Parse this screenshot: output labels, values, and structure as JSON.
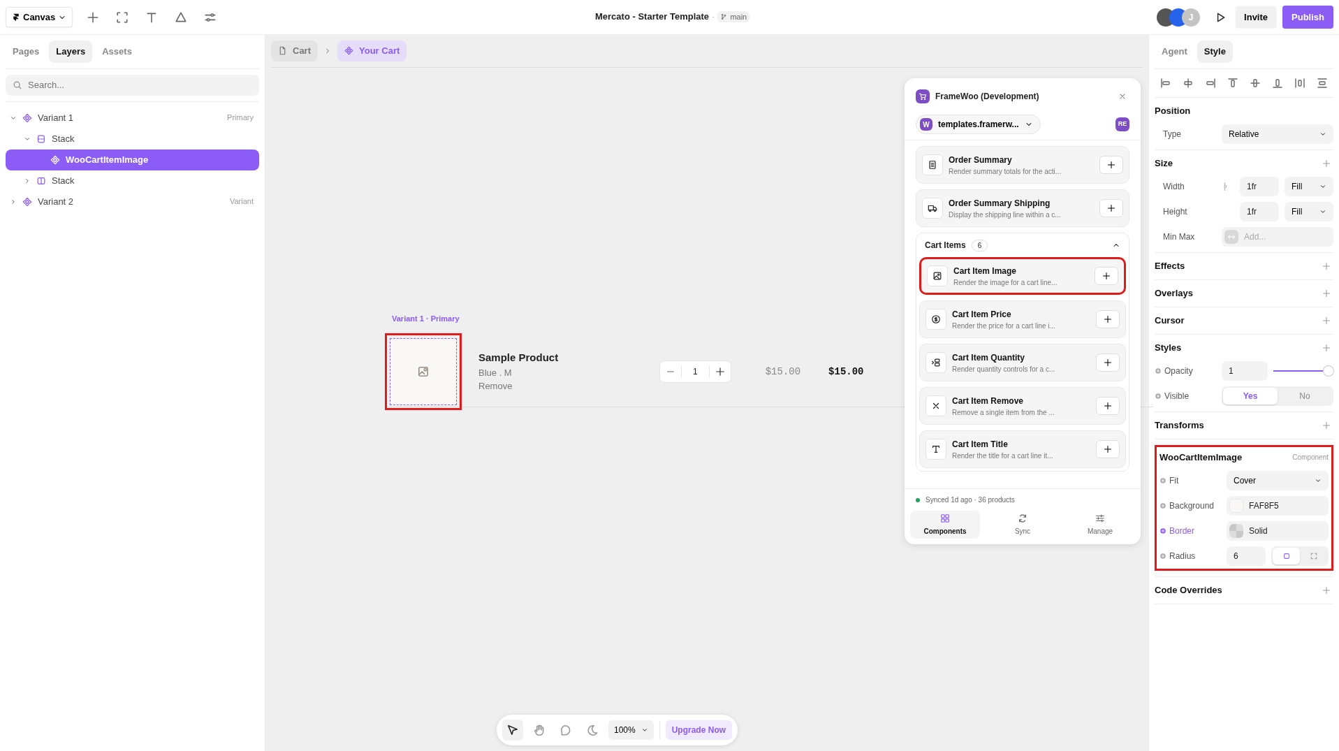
{
  "topbar": {
    "menu": "Canvas",
    "title": "Mercato - Starter Template",
    "separator": "·",
    "branch": "main",
    "avatar_initial": "J",
    "buttons": [
      {
        "label": "Invite",
        "kind": "secondary"
      },
      {
        "label": "Publish",
        "kind": "primary"
      }
    ]
  },
  "left_panel": {
    "tabs": [
      {
        "label": "Pages",
        "selected": false
      },
      {
        "label": "Layers",
        "selected": true
      },
      {
        "label": "Assets",
        "selected": false
      }
    ],
    "search": {
      "placeholder": "Search..."
    },
    "layers": [
      {
        "label": "Variant 1",
        "kind": "component",
        "badge": "Primary",
        "expanded": true,
        "selected": false,
        "children": [
          {
            "label": "Stack",
            "kind": "stack-vertical",
            "expanded": true,
            "selected": false,
            "children": [
              {
                "label": "WooCartItemImage",
                "kind": "component",
                "selected": true
              }
            ]
          },
          {
            "label": "Stack",
            "kind": "stack-horizontal",
            "expanded": false,
            "selected": false
          }
        ]
      },
      {
        "label": "Variant 2",
        "kind": "component",
        "badge": "Variant",
        "expanded": false,
        "selected": false
      }
    ]
  },
  "breadcrumb": [
    {
      "label": "Cart",
      "kind": "page",
      "selected": false
    },
    {
      "label": "Your Cart",
      "kind": "component",
      "selected": true
    }
  ],
  "canvas": {
    "frame_label": "Variant 1 · Primary",
    "product": {
      "image_highlighted": true,
      "title": "Sample Product",
      "variant": "Blue . M",
      "remove": "Remove",
      "quantity": "1",
      "price": "$15.00",
      "total": "$15.00"
    }
  },
  "plugin": {
    "title": "FrameWoo (Development)",
    "site_badge": "W",
    "site": "templates.framerw...",
    "user_badge": "RE",
    "items": [
      {
        "kind": "item",
        "title": "Order Summary",
        "description": "Render summary totals for the acti...",
        "highlighted": false
      },
      {
        "kind": "item",
        "title": "Order Summary Shipping",
        "description": "Display the shipping line within a c...",
        "highlighted": false
      },
      {
        "kind": "group",
        "title": "Cart Items",
        "count": "6",
        "expanded": true,
        "children": [
          {
            "title": "Cart Item Image",
            "description": "Render the image for a cart line...",
            "highlighted": true
          },
          {
            "title": "Cart Item Price",
            "description": "Render the price for a cart line i...",
            "highlighted": false
          },
          {
            "title": "Cart Item Quantity",
            "description": "Render quantity controls for a c...",
            "highlighted": false
          },
          {
            "title": "Cart Item Remove",
            "description": "Remove a single item from the ...",
            "highlighted": false
          },
          {
            "title": "Cart Item Title",
            "description": "Render the title for a cart line it...",
            "highlighted": false
          }
        ]
      }
    ],
    "status": {
      "text": "Synced 1d ago · 36 products",
      "color": "#22a35a"
    },
    "tabs": [
      {
        "label": "Components",
        "selected": true
      },
      {
        "label": "Sync",
        "selected": false
      },
      {
        "label": "Manage",
        "selected": false
      }
    ]
  },
  "inspector": {
    "tabs": [
      {
        "label": "Agent",
        "selected": false
      },
      {
        "label": "Style",
        "selected": true
      }
    ],
    "sections": [
      {
        "title": "Position",
        "addable": false,
        "rows": [
          {
            "kind": "select",
            "label": "Type",
            "value": "Relative"
          }
        ]
      },
      {
        "title": "Size",
        "addable": true,
        "rows": [
          {
            "kind": "pair",
            "label": "Width",
            "value": "1fr",
            "unit": "Fill"
          },
          {
            "kind": "pair",
            "label": "Height",
            "value": "1fr",
            "unit": "Fill"
          },
          {
            "kind": "add",
            "label": "Min Max",
            "placeholder": "Add..."
          }
        ]
      },
      {
        "title": "Effects",
        "addable": true
      },
      {
        "title": "Overlays",
        "addable": true
      },
      {
        "title": "Cursor",
        "addable": true
      },
      {
        "title": "Styles",
        "addable": true,
        "rows": [
          {
            "kind": "slider",
            "label": "Opacity",
            "value": "1",
            "level": 1,
            "bound": false
          },
          {
            "kind": "segmented",
            "label": "Visible",
            "bound": false,
            "options": [
              {
                "label": "Yes",
                "selected": true
              },
              {
                "label": "No",
                "selected": false
              }
            ]
          }
        ]
      },
      {
        "title": "Transforms",
        "addable": true
      },
      {
        "title": "WooCartItemImage",
        "tag": "Component",
        "highlighted": true,
        "addable": false,
        "rows": [
          {
            "kind": "select",
            "label": "Fit",
            "value": "Cover",
            "bound": false
          },
          {
            "kind": "color",
            "label": "Background",
            "value": "FAF8F5",
            "color": "#faf8f5",
            "bound": false
          },
          {
            "kind": "border",
            "label": "Border",
            "value": "Solid",
            "bound": true
          },
          {
            "kind": "radius",
            "label": "Radius",
            "value": "6",
            "bound": false,
            "options": [
              {
                "selected": true
              },
              {
                "selected": false
              }
            ]
          }
        ]
      },
      {
        "title": "Code Overrides",
        "addable": true
      }
    ]
  },
  "bottom_toolbar": {
    "tools": [
      {
        "selected": true
      },
      {
        "selected": false
      },
      {
        "selected": false
      },
      {
        "selected": false
      }
    ],
    "zoom": "100%",
    "upgrade": "Upgrade Now"
  }
}
